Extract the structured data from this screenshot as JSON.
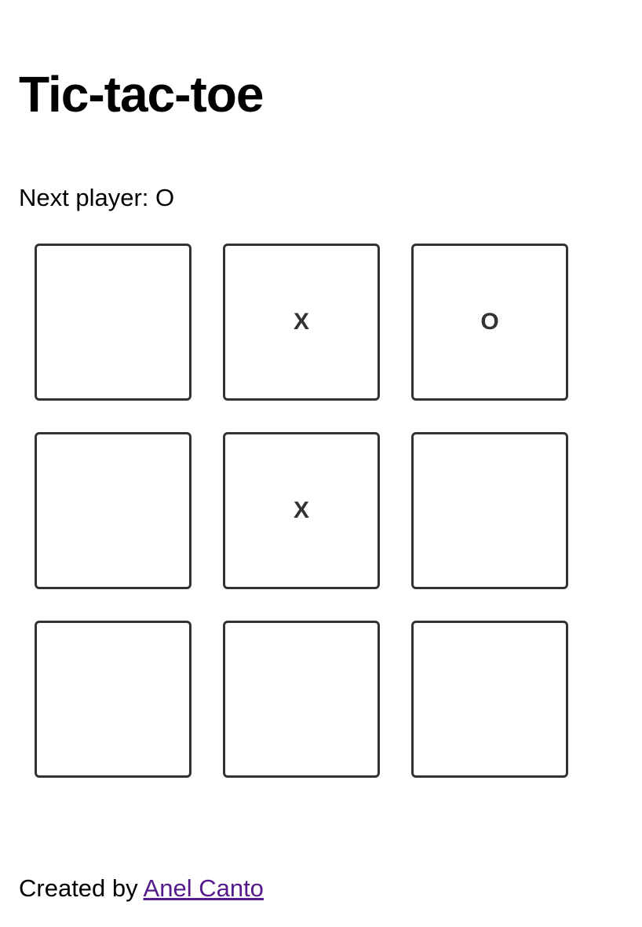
{
  "title": "Tic-tac-toe",
  "status": {
    "label": "Next player: O"
  },
  "board": {
    "squares": [
      "",
      "X",
      "O",
      "",
      "X",
      "",
      "",
      "",
      ""
    ]
  },
  "footer": {
    "prefix": "Created by ",
    "author_link": "Anel Canto"
  },
  "colors": {
    "square_border": "#333333",
    "link": "#551a8b",
    "text": "#000000",
    "background": "#ffffff"
  }
}
